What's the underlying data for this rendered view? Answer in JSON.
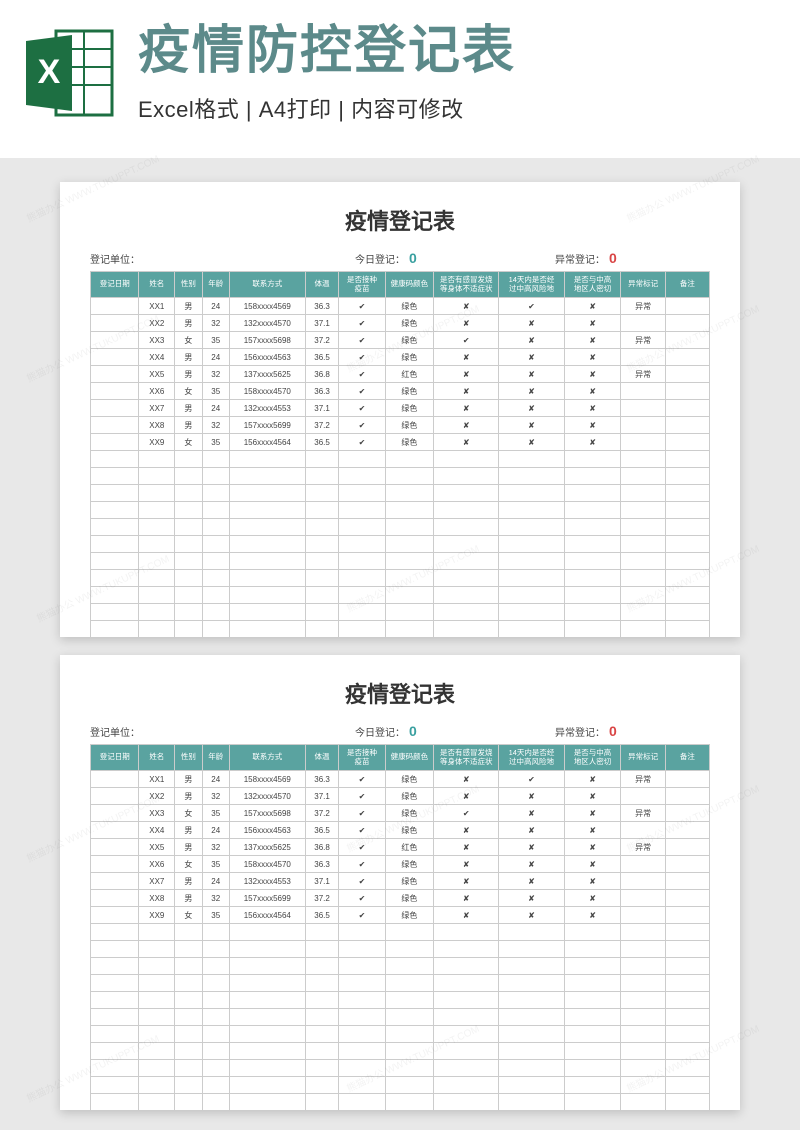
{
  "header": {
    "main_title": "疫情防控登记表",
    "sub_title": "Excel格式 | A4打印 | 内容可修改"
  },
  "sheet": {
    "title": "疫情登记表",
    "meta": {
      "unit_label": "登记单位：",
      "today_label": "今日登记：",
      "today_value": "0",
      "abnormal_label": "异常登记：",
      "abnormal_value": "0"
    },
    "columns": [
      "登记日期",
      "姓名",
      "性别",
      "年龄",
      "联系方式",
      "体温",
      "是否接种\n疫苗",
      "健康码颜色",
      "是否有感冒发烧\n等身体不适症状",
      "14天内是否经\n过中高风险地",
      "是否与中高\n地区人密切",
      "异常标记",
      "备注"
    ],
    "rows": [
      {
        "date": "",
        "name": "XX1",
        "gender": "男",
        "age": "24",
        "contact": "158xxxx4569",
        "temp": "36.3",
        "vaccine": true,
        "health": "绿色",
        "symptom": false,
        "travel": true,
        "close": false,
        "flag": "异常",
        "remark": ""
      },
      {
        "date": "",
        "name": "XX2",
        "gender": "男",
        "age": "32",
        "contact": "132xxxx4570",
        "temp": "37.1",
        "vaccine": true,
        "health": "绿色",
        "symptom": false,
        "travel": false,
        "close": false,
        "flag": "",
        "remark": ""
      },
      {
        "date": "",
        "name": "XX3",
        "gender": "女",
        "age": "35",
        "contact": "157xxxx5698",
        "temp": "37.2",
        "vaccine": true,
        "health": "绿色",
        "symptom": true,
        "travel": false,
        "close": false,
        "flag": "异常",
        "remark": ""
      },
      {
        "date": "",
        "name": "XX4",
        "gender": "男",
        "age": "24",
        "contact": "156xxxx4563",
        "temp": "36.5",
        "vaccine": true,
        "health": "绿色",
        "symptom": false,
        "travel": false,
        "close": false,
        "flag": "",
        "remark": ""
      },
      {
        "date": "",
        "name": "XX5",
        "gender": "男",
        "age": "32",
        "contact": "137xxxx5625",
        "temp": "36.8",
        "vaccine": true,
        "health": "红色",
        "health_red": true,
        "symptom": false,
        "travel": false,
        "close": false,
        "flag": "异常",
        "remark": ""
      },
      {
        "date": "",
        "name": "XX6",
        "gender": "女",
        "age": "35",
        "contact": "158xxxx4570",
        "temp": "36.3",
        "vaccine": true,
        "health": "绿色",
        "symptom": false,
        "travel": false,
        "close": false,
        "flag": "",
        "remark": ""
      },
      {
        "date": "",
        "name": "XX7",
        "gender": "男",
        "age": "24",
        "contact": "132xxxx4553",
        "temp": "37.1",
        "vaccine": true,
        "health": "绿色",
        "symptom": false,
        "travel": false,
        "close": false,
        "flag": "",
        "remark": ""
      },
      {
        "date": "",
        "name": "XX8",
        "gender": "男",
        "age": "32",
        "contact": "157xxxx5699",
        "temp": "37.2",
        "vaccine": true,
        "health": "绿色",
        "symptom": false,
        "travel": false,
        "close": false,
        "flag": "",
        "remark": ""
      },
      {
        "date": "",
        "name": "XX9",
        "gender": "女",
        "age": "35",
        "contact": "156xxxx4564",
        "temp": "36.5",
        "vaccine": true,
        "health": "绿色",
        "symptom": false,
        "travel": false,
        "close": false,
        "flag": "",
        "remark": ""
      }
    ],
    "empty_rows": 11
  },
  "watermark": "熊猫办公 WWW.TUKUPPT.COM"
}
